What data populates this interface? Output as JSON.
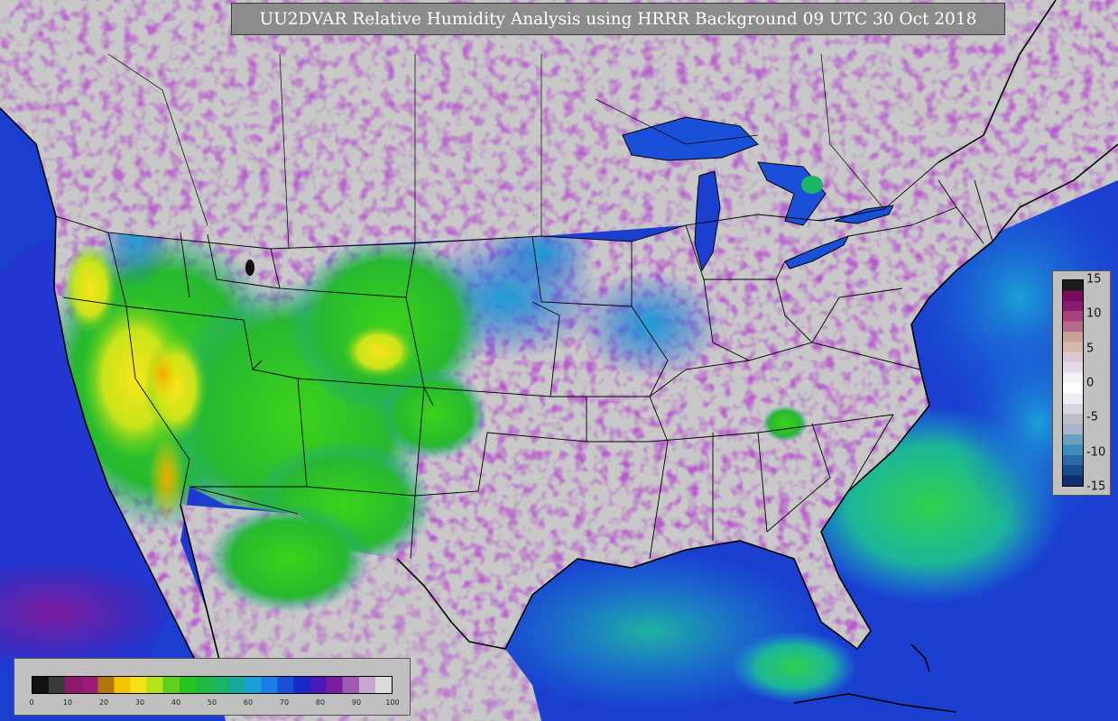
{
  "title": "UU2DVAR Relative Humidity Analysis using HRRR Background 09 UTC 30 Oct 2018",
  "colors": {
    "ocean": "#1a3fcf",
    "land_dry": "#c8c8c8",
    "moist": "#7a1a8c",
    "mid": "#1f9fd6",
    "green": "#26c626",
    "yellow": "#f3e21a",
    "border": "#000000"
  },
  "rh_colorbar": {
    "ticks": [
      "0",
      "10",
      "20",
      "30",
      "40",
      "50",
      "60",
      "70",
      "80",
      "90",
      "100"
    ],
    "colors": [
      "#111111",
      "#3a3a3a",
      "#8a1a6a",
      "#9c1a78",
      "#b0760e",
      "#f5c400",
      "#f6e11a",
      "#b6e31a",
      "#5fd01f",
      "#25c51f",
      "#1fba3f",
      "#1db468",
      "#1aa79a",
      "#1c9fd6",
      "#1b7ee6",
      "#1a50d8",
      "#1a28c8",
      "#4a1ab6",
      "#7a1a9c",
      "#a05ab0",
      "#c8a8d0",
      "#dcdcdc"
    ]
  },
  "diff_colorbar": {
    "ticks": [
      "15",
      "10",
      "5",
      "0",
      "-5",
      "-10",
      "-15"
    ],
    "colors": [
      "#1c1c1c",
      "#7a0a5c",
      "#8c1a6c",
      "#a8407c",
      "#b56a8a",
      "#c8a098",
      "#d8b8aa",
      "#dcc8d4",
      "#e4dce8",
      "#f4f4f4",
      "#ffffff",
      "#f0eef2",
      "#d8d4e0",
      "#c0c0c8",
      "#a8b4c8",
      "#6aa0c0",
      "#3a8cbc",
      "#2a6aa8",
      "#1a4c90",
      "#0e2f72"
    ]
  }
}
